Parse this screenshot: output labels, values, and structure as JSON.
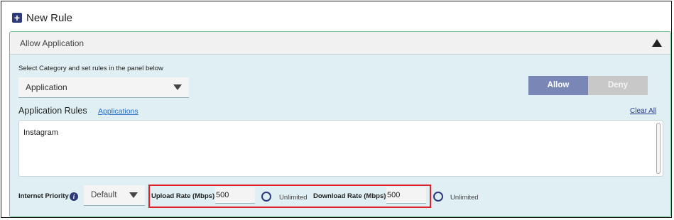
{
  "header": {
    "title": "New Rule",
    "add_icon": "plus-square-icon"
  },
  "rule": {
    "section_title": "Allow Application",
    "category_label": "Select Category and set rules in the panel below",
    "category_value": "Application",
    "actions": {
      "allow_label": "Allow",
      "deny_label": "Deny",
      "selected": "Allow"
    },
    "app_rules_title": "Application Rules",
    "applications_link": "Applications",
    "clear_all_label": "Clear All",
    "rules_text": "Instagram",
    "internet_priority_label": "Internet Priority",
    "internet_priority_value": "Default",
    "upload_label": "Upload Rate (Mbps)",
    "upload_value": "500",
    "upload_unlimited_label": "Unlimited",
    "download_label": "Download Rate (Mbps)",
    "download_value": "500",
    "download_unlimited_label": "Unlimited"
  },
  "colors": {
    "accent": "#2f3a7a",
    "allow_button": "#7a86b6",
    "deny_button": "#c8c8c8",
    "panel_bg": "#dfeff4",
    "highlight_border": "#e0202a",
    "link": "#2a6fc9"
  }
}
